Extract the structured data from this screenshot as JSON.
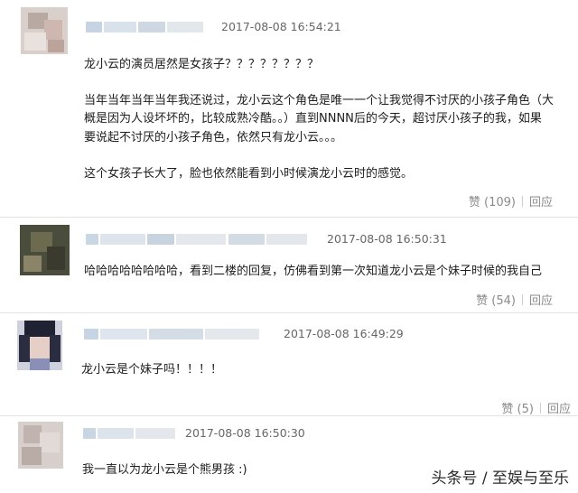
{
  "comments": [
    {
      "timestamp": "2017-08-08 16:54:21",
      "lines": [
        "龙小云的演员居然是女孩子？？？？？？？？",
        "",
        "当年当年当年当年我还说过，龙小云这个角色是唯一一个让我觉得不讨厌的小孩子角色（大",
        "概是因为人设坏坏的，比较成熟冷酷。。）直到NNNN后的今天，超讨厌小孩子的我，如果",
        "要说起不讨厌的小孩子角色，依然只有龙小云。。。",
        "",
        "这个女孩子长大了，脸也依然能看到小时候演龙小云时的感觉。"
      ],
      "like_label": "赞 (109)",
      "reply_label": "回应"
    },
    {
      "timestamp": "2017-08-08 16:50:31",
      "lines": [
        "哈哈哈哈哈哈哈哈，看到二楼的回复，仿佛看到第一次知道龙小云是个妹子时候的我自己"
      ],
      "like_label": "赞 (54)",
      "reply_label": "回应"
    },
    {
      "timestamp": "2017-08-08 16:49:29",
      "lines": [
        "龙小云是个妹子吗！！！！"
      ],
      "like_label": "赞 (5)",
      "reply_label": "回应"
    },
    {
      "timestamp": "2017-08-08 16:50:30",
      "lines": [
        "我一直以为龙小云是个熊男孩 :)"
      ],
      "like_label": "",
      "reply_label": ""
    }
  ],
  "watermark": "头条号 / 至娱与至乐"
}
